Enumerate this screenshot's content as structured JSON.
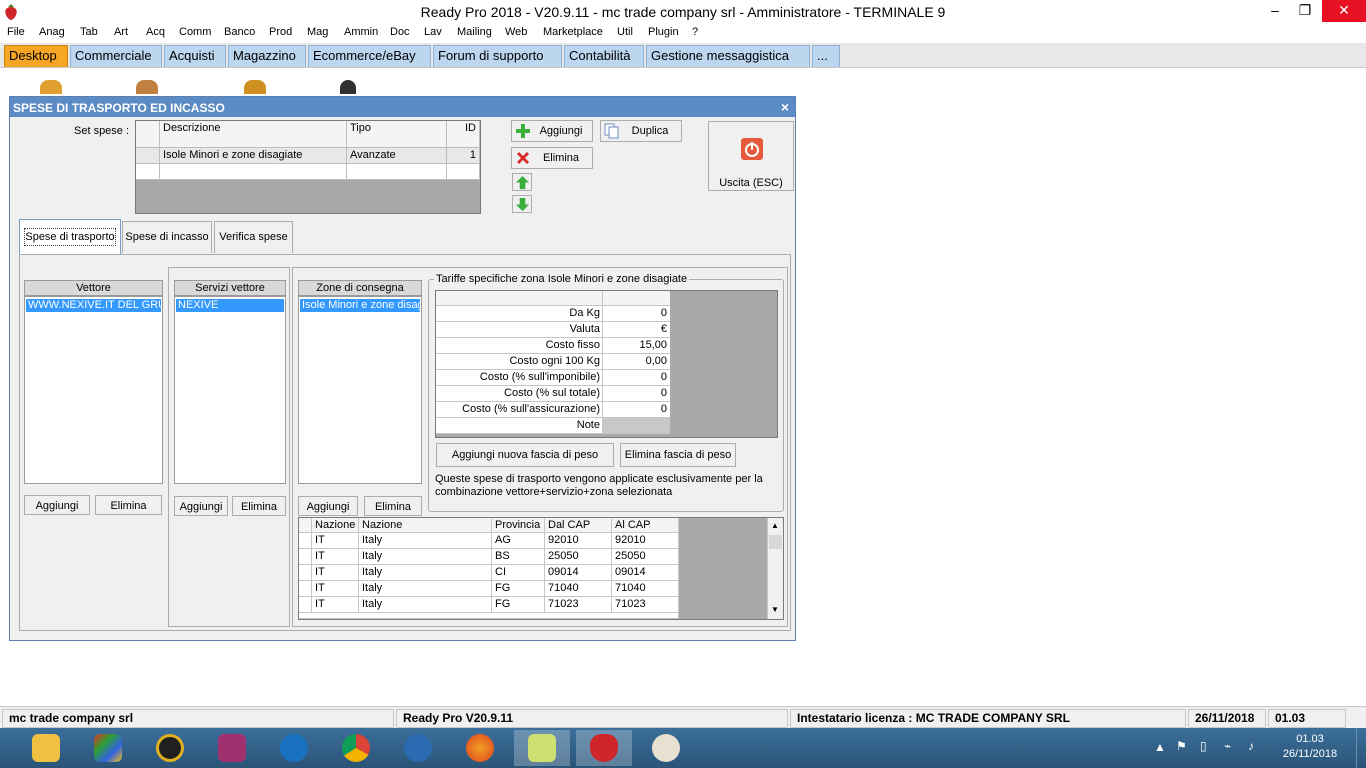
{
  "window": {
    "title": "Ready Pro 2018 - V20.9.11 - mc trade company srl - Amministratore - TERMINALE 9",
    "minimize": "–",
    "maximize": "❐",
    "close": "✕"
  },
  "menu": [
    "File",
    "Anag",
    "Tab",
    "Art",
    "Acq",
    "Comm",
    "Banco",
    "Prod",
    "Mag",
    "Ammin",
    "Doc",
    "Lav",
    "Mailing",
    "Web",
    "Marketplace",
    "Util",
    "Plugin",
    "?"
  ],
  "module_tabs": [
    "Desktop",
    "Commerciale",
    "Acquisti",
    "Magazzino",
    "Ecommerce/eBay",
    "Forum di supporto",
    "Contabilità",
    "Gestione messaggistica",
    "..."
  ],
  "dialog": {
    "title": "SPESE DI TRASPORTO ED INCASSO",
    "close": "×",
    "set_label": "Set spese :",
    "set_grid": {
      "headers": [
        "Descrizione",
        "Tipo",
        "ID"
      ],
      "rows": [
        [
          "Isole Minori e zone disagiate",
          "Avanzate",
          "1"
        ]
      ]
    },
    "buttons": {
      "add": "Aggiungi",
      "duplicate": "Duplica",
      "delete": "Elimina",
      "exit": "Uscita (ESC)"
    },
    "tabs": [
      "Spese di trasporto",
      "Spese di incasso",
      "Verifica spese"
    ],
    "vettore": {
      "header": "Vettore",
      "selected": "WWW.NEXIVE.IT DEL GRUPPO POSTNL",
      "add": "Aggiungi",
      "delete": "Elimina"
    },
    "servizi": {
      "header": "Servizi vettore",
      "selected": "NEXIVE",
      "add": "Aggiungi",
      "delete": "Elimina"
    },
    "zone": {
      "header": "Zone di consegna",
      "selected": "Isole Minori e zone disagiate",
      "add": "Aggiungi",
      "delete": "Elimina"
    },
    "tariffe": {
      "title": "Tariffe specifiche zona Isole Minori e zone disagiate",
      "rows": [
        {
          "label": "Da Kg",
          "value": "0"
        },
        {
          "label": "Valuta",
          "value": "€"
        },
        {
          "label": "Costo fisso",
          "value": "15,00"
        },
        {
          "label": "Costo ogni 100 Kg",
          "value": "0,00"
        },
        {
          "label": "Costo (% sull'imponibile)",
          "value": "0"
        },
        {
          "label": "Costo (% sul totale)",
          "value": "0"
        },
        {
          "label": "Costo (% sull'assicurazione)",
          "value": "0"
        },
        {
          "label": "Note",
          "value": ""
        }
      ],
      "add_band": "Aggiungi nuova fascia di peso",
      "delete_band": "Elimina fascia di peso",
      "note": "Queste spese di trasporto vengono applicate esclusivamente per la combinazione vettore+servizio+zona selezionata"
    },
    "cap_grid": {
      "headers": [
        "Nazione",
        "Nazione",
        "Provincia",
        "Dal CAP",
        "Al CAP"
      ],
      "rows": [
        [
          "IT",
          "Italy",
          "AG",
          "92010",
          "92010"
        ],
        [
          "IT",
          "Italy",
          "BS",
          "25050",
          "25050"
        ],
        [
          "IT",
          "Italy",
          "CI",
          "09014",
          "09014"
        ],
        [
          "IT",
          "Italy",
          "FG",
          "71040",
          "71040"
        ],
        [
          "IT",
          "Italy",
          "FG",
          "71023",
          "71023"
        ]
      ]
    }
  },
  "statusbar": {
    "company": "mc trade company srl",
    "version": "Ready Pro V20.9.11",
    "license": "Intestatario licenza : MC TRADE COMPANY SRL",
    "date": "26/11/2018",
    "time": "01.03"
  },
  "taskbar": {
    "time": "01.03",
    "date": "26/11/2018"
  },
  "colors": {
    "accent_tab": "#f7a623",
    "dialog_title": "#5b8bc4",
    "selection": "#3399ff",
    "close_red": "#e81123"
  }
}
